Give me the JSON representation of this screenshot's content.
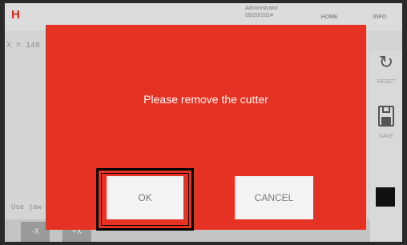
{
  "app": {
    "logo": "H"
  },
  "header": {
    "datetime_line1": "Administrator",
    "datetime_line2": "05/20/2014",
    "datetime_line3": "",
    "home_label": "HOME",
    "info_label": "INFO"
  },
  "background": {
    "coord_text": "X = 148",
    "jaw_text": "Use jaw",
    "minus_x_label": "-X",
    "plus_x_label": "+X"
  },
  "side_panel": {
    "reset_label": "RESET",
    "save_label": "SAVE"
  },
  "dialog": {
    "message": "Please remove the cutter",
    "ok_label": "OK",
    "cancel_label": "CANCEL"
  },
  "colors": {
    "dialog_background": "#e53222",
    "accent": "#d62c1f"
  },
  "icons": {
    "reset": "reset-arrow-icon",
    "save": "floppy-disk-icon"
  }
}
